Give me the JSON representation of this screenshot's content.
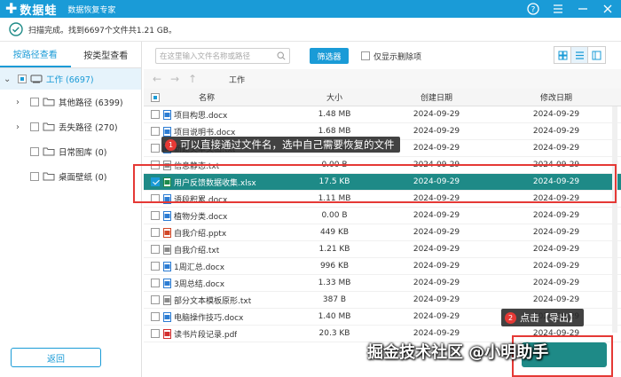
{
  "app": {
    "name": "数据蛙",
    "subtitle": "数据恢复专家"
  },
  "window_buttons": [
    "help-icon",
    "menu-icon",
    "minimize-icon",
    "close-icon"
  ],
  "status": {
    "text": "扫描完成。找到6697个文件共1.21 GB。"
  },
  "left": {
    "tabs": [
      {
        "label": "按路径查看",
        "active": true
      },
      {
        "label": "按类型查看",
        "active": false
      }
    ],
    "tree_root": {
      "label": "工作 (6697)"
    },
    "tree_items": [
      {
        "label": "其他路径 (6399)",
        "expandable": true
      },
      {
        "label": "丢失路径 (270)",
        "expandable": true
      },
      {
        "label": "日常图库 (0)",
        "expandable": false
      },
      {
        "label": "桌面壁纸 (0)",
        "expandable": false
      }
    ],
    "back_label": "返回"
  },
  "toolbar": {
    "search_placeholder": "在这里输入文件名称或路径",
    "filter_label": "筛选器",
    "only_deleted_label": "仅显示删除项"
  },
  "nav": {
    "crumb": "工作"
  },
  "table": {
    "headers": {
      "name": "名称",
      "size": "大小",
      "created": "创建日期",
      "modified": "修改日期"
    },
    "rows": [
      {
        "name": "项目构思.docx",
        "size": "1.48 MB",
        "created": "2024-09-29",
        "modified": "2024-09-29",
        "type": "word",
        "checked": false,
        "selected": false
      },
      {
        "name": "项目说明书.docx",
        "size": "1.68 MB",
        "created": "2024-09-29",
        "modified": "2024-09-29",
        "type": "word",
        "checked": false,
        "selected": false
      },
      {
        "name": "新建文本文档.txt",
        "size": "2.39 KB",
        "created": "2024-09-29",
        "modified": "2024-09-29",
        "type": "word",
        "checked": false,
        "selected": false
      },
      {
        "name": "信息静态.txt",
        "size": "0.00 B",
        "created": "2024-09-29",
        "modified": "2024-09-29",
        "type": "txt",
        "checked": false,
        "selected": false
      },
      {
        "name": "用户反馈数据收集.xlsx",
        "size": "17.5 KB",
        "created": "2024-09-29",
        "modified": "2024-09-29",
        "type": "xls",
        "checked": true,
        "selected": true
      },
      {
        "name": "语段积累.docx",
        "size": "1.11 MB",
        "created": "2024-09-29",
        "modified": "2024-09-29",
        "type": "word",
        "checked": false,
        "selected": false
      },
      {
        "name": "植物分类.docx",
        "size": "0.00 B",
        "created": "2024-09-29",
        "modified": "2024-09-29",
        "type": "word",
        "checked": false,
        "selected": false
      },
      {
        "name": "自我介绍.pptx",
        "size": "449 KB",
        "created": "2024-09-29",
        "modified": "2024-09-29",
        "type": "ppt",
        "checked": false,
        "selected": false
      },
      {
        "name": "自我介绍.txt",
        "size": "1.21 KB",
        "created": "2024-09-29",
        "modified": "2024-09-29",
        "type": "txt",
        "checked": false,
        "selected": false
      },
      {
        "name": "1周汇总.docx",
        "size": "996 KB",
        "created": "2024-09-29",
        "modified": "2024-09-29",
        "type": "word",
        "checked": false,
        "selected": false
      },
      {
        "name": "3周总结.docx",
        "size": "1.33 MB",
        "created": "2024-09-29",
        "modified": "2024-09-29",
        "type": "word",
        "checked": false,
        "selected": false
      },
      {
        "name": "部分文本模板原形.txt",
        "size": "387 B",
        "created": "2024-09-29",
        "modified": "2024-09-29",
        "type": "txt",
        "checked": false,
        "selected": false
      },
      {
        "name": "电脑操作技巧.docx",
        "size": "1.40 MB",
        "created": "2024-09-29",
        "modified": "2024-09-29",
        "type": "word",
        "checked": false,
        "selected": false
      },
      {
        "name": "读书片段记录.pdf",
        "size": "20.3 KB",
        "created": "2024-09-29",
        "modified": "2024-09-29",
        "type": "pdf",
        "checked": false,
        "selected": false
      }
    ]
  },
  "annotations": {
    "tip1_number": "1",
    "tip1_text": "可以直接通过文件名，选中自己需要恢复的文件",
    "tip2_number": "2",
    "tip2_text": "点击【导出】"
  },
  "watermark": "掘金技术社区 @小明助手",
  "colors": {
    "brand": "#1a9bd7",
    "selected_row": "#1e8a87",
    "highlight": "#e53935"
  }
}
